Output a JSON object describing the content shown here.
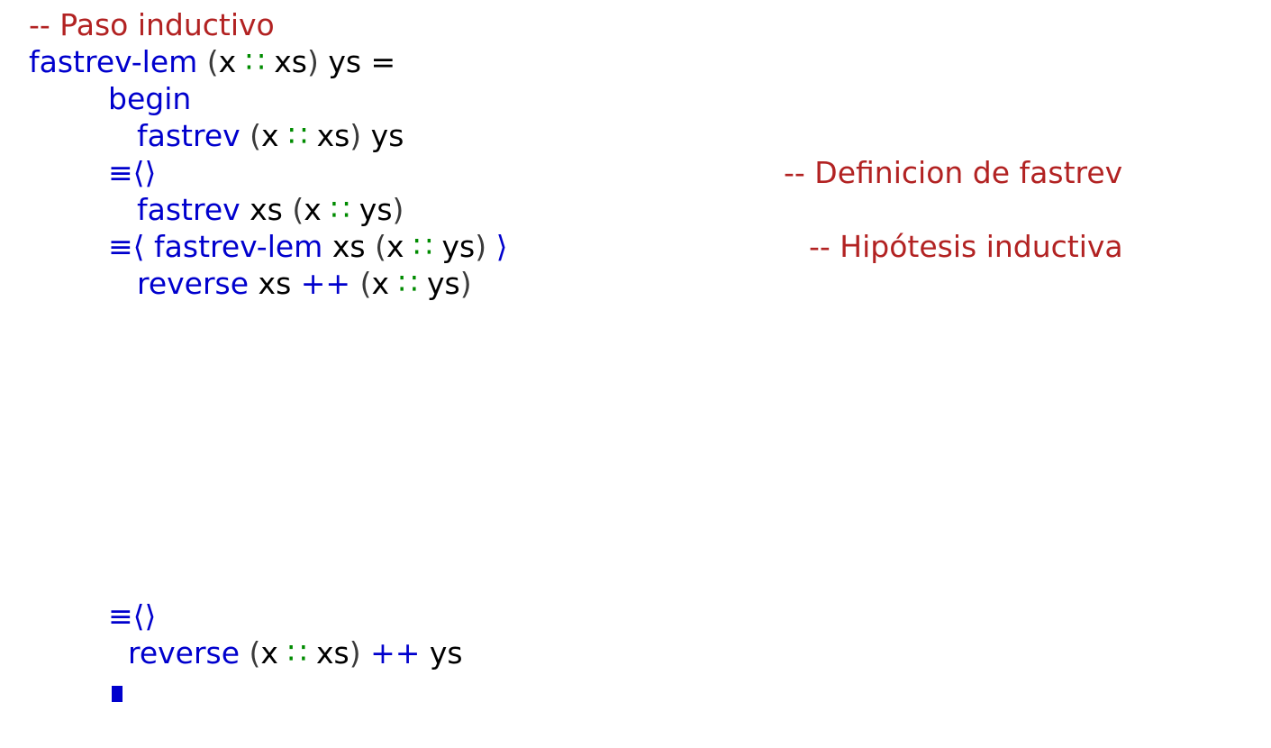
{
  "lines": {
    "comment_step": "-- Paso inductivo",
    "lemma_head": {
      "fn": "fastrev-lem",
      "open": "(",
      "x": "x",
      "cons": "∷",
      "xs": "xs",
      "close": ")",
      "ys": "ys",
      "eq": "="
    },
    "begin": "begin",
    "step1": {
      "fn": "fastrev",
      "open": "(",
      "x": "x",
      "cons": "∷",
      "xs": "xs",
      "close": ")",
      "ys": "ys"
    },
    "reason1": {
      "op": "≡⟨⟩",
      "comment": "-- Definicion de fastrev"
    },
    "step2": {
      "fn": "fastrev",
      "xs": "xs",
      "open": "(",
      "x": "x",
      "cons": "∷",
      "ys": "ys",
      "close": ")"
    },
    "reason2": {
      "op_open": "≡⟨",
      "fn": "fastrev-lem",
      "xs": "xs",
      "open": "(",
      "x": "x",
      "cons": "∷",
      "ys": "ys",
      "close": ")",
      "op_close": "⟩",
      "comment": "-- Hipótesis inductiva"
    },
    "step3": {
      "fn": "reverse",
      "xs": "xs",
      "append": "++",
      "open": "(",
      "x": "x",
      "cons": "∷",
      "ys": "ys",
      "close": ")"
    },
    "reason3": {
      "op": "≡⟨⟩"
    },
    "goal": {
      "fn": "reverse",
      "open": "(",
      "x": "x",
      "cons": "∷",
      "xs": "xs",
      "close": ")",
      "append": "++",
      "ys": "ys"
    },
    "qed": "∎"
  },
  "colors": {
    "keyword": "#0000cd",
    "variable": "#000000",
    "constructor": "#008b00",
    "comment": "#b22222",
    "paren": "#3a3a3a"
  }
}
